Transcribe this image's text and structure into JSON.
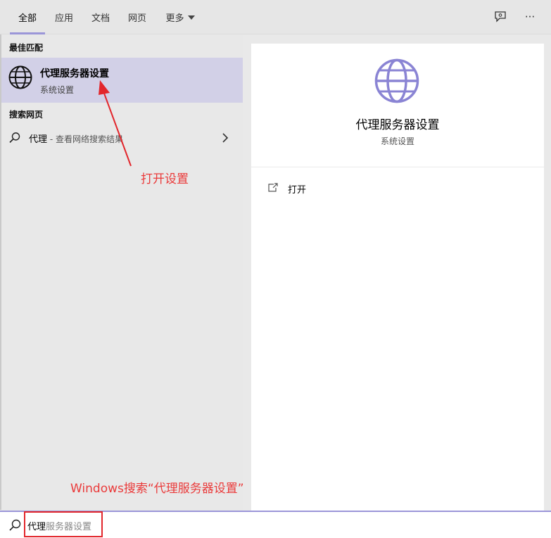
{
  "tabs": [
    {
      "label": "全部",
      "active": true
    },
    {
      "label": "应用",
      "active": false
    },
    {
      "label": "文档",
      "active": false
    },
    {
      "label": "网页",
      "active": false
    },
    {
      "label": "更多",
      "active": false
    }
  ],
  "top_icons": [
    "feedback-icon",
    "more-options-icon"
  ],
  "more_options_label": "···",
  "left": {
    "best_match_header": "最佳匹配",
    "best_match": {
      "title": "代理服务器设置",
      "subtitle": "系统设置",
      "icon": "globe-icon"
    },
    "web_header": "搜索网页",
    "web_item": {
      "term": "代理",
      "suffix": " - 查看网络搜索结果",
      "icon": "search-icon"
    }
  },
  "right": {
    "title": "代理服务器设置",
    "subtitle": "系统设置",
    "actions": [
      {
        "label": "打开",
        "icon": "open-icon"
      }
    ]
  },
  "search": {
    "typed": "代理",
    "suggestion": "服务器设置"
  },
  "annotations": {
    "open_settings": "打开设置",
    "search_hint": "Windows搜索“代理服务器设置”"
  },
  "colors": {
    "accent": "#9b96d8",
    "selection": "#d2d0e7",
    "annotation": "#e2262c"
  }
}
